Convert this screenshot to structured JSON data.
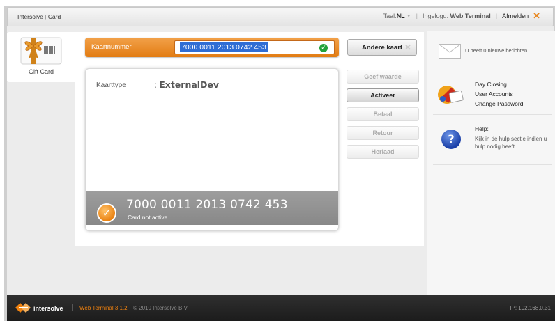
{
  "topbar": {
    "app_name": "Intersolve",
    "section": "Card",
    "lang_label": "Taal:",
    "lang_value": "NL",
    "logged_in_label": "Ingelogd:",
    "user": "Web Terminal",
    "logout": "Afmelden"
  },
  "nav": {
    "gift_card_label": "Gift Card"
  },
  "card_entry": {
    "label": "Kaartnummer",
    "value": "7000 0011 2013 0742 453",
    "other_card_button": "Andere kaart"
  },
  "card_info": {
    "type_label": "Kaarttype",
    "type_value": "ExternalDev",
    "status_number": "7000 0011 2013 0742 453",
    "status_text": "Card not active"
  },
  "actions": [
    {
      "label": "Geef waarde",
      "enabled": false
    },
    {
      "label": "Activeer",
      "enabled": true
    },
    {
      "label": "Betaal",
      "enabled": false
    },
    {
      "label": "Retour",
      "enabled": false
    },
    {
      "label": "Herlaad",
      "enabled": false
    }
  ],
  "sidebar": {
    "messages_text": "U heeft 0 nieuwe berichten.",
    "links": [
      "Day Closing",
      "User Accounts",
      "Change Password"
    ],
    "help_title": "Help:",
    "help_body": "Kijk in de hulp sectie indien u hulp nodig heeft."
  },
  "footer": {
    "brand": "intersolve",
    "version": "Web Terminal 3.1.2",
    "copyright": "© 2010 Intersolve B.V.",
    "ip": "IP: 192.168.0.31"
  },
  "colors": {
    "accent": "#e8851c",
    "selection": "#2f6dd4",
    "ok": "#23a23a",
    "help": "#1b40a8"
  }
}
